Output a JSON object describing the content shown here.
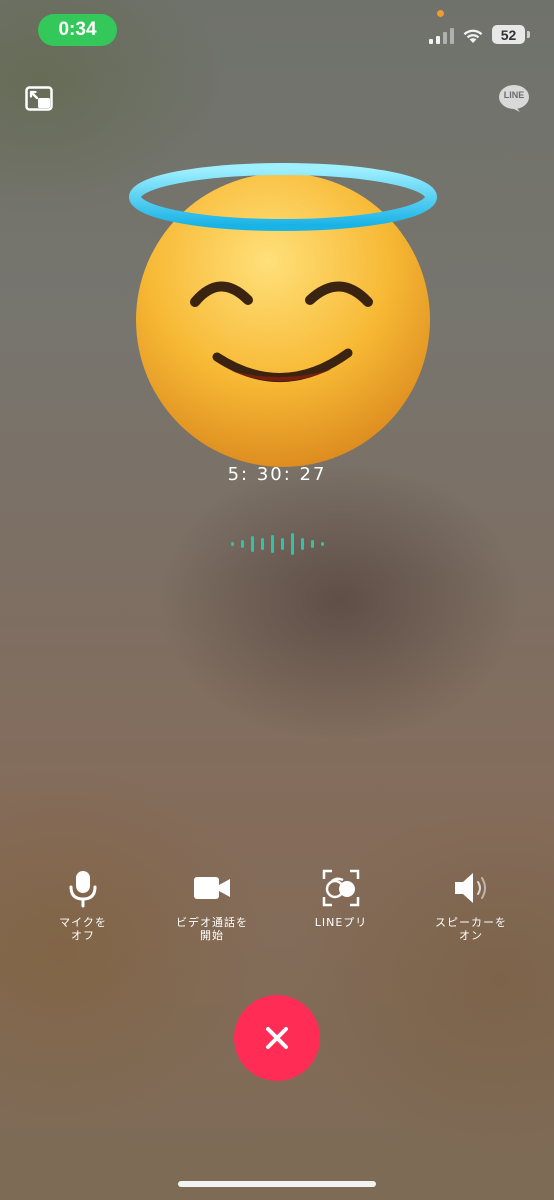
{
  "status_bar": {
    "time": "0:34",
    "battery_level": "52",
    "time_pill_color": "#34c759",
    "privacy_dot_color": "#f29a2e"
  },
  "header": {
    "minimize_icon": "picture-in-picture-icon",
    "app_logo_text": "LINE"
  },
  "call": {
    "avatar_icon": "smiling-face-with-halo-emoji",
    "timer": "5: 30: 27",
    "voice_indicator_color": "#2fc3a8"
  },
  "controls": [
    {
      "icon": "microphone-icon",
      "label": "マイクを\nオフ"
    },
    {
      "icon": "video-camera-icon",
      "label": "ビデオ通話を\n開始"
    },
    {
      "icon": "line-puri-face-icon",
      "label": "LINEプリ"
    },
    {
      "icon": "speaker-icon",
      "label": "スピーカーを\nオン"
    }
  ],
  "end_call": {
    "icon": "close-icon",
    "color": "#ff2d55"
  }
}
